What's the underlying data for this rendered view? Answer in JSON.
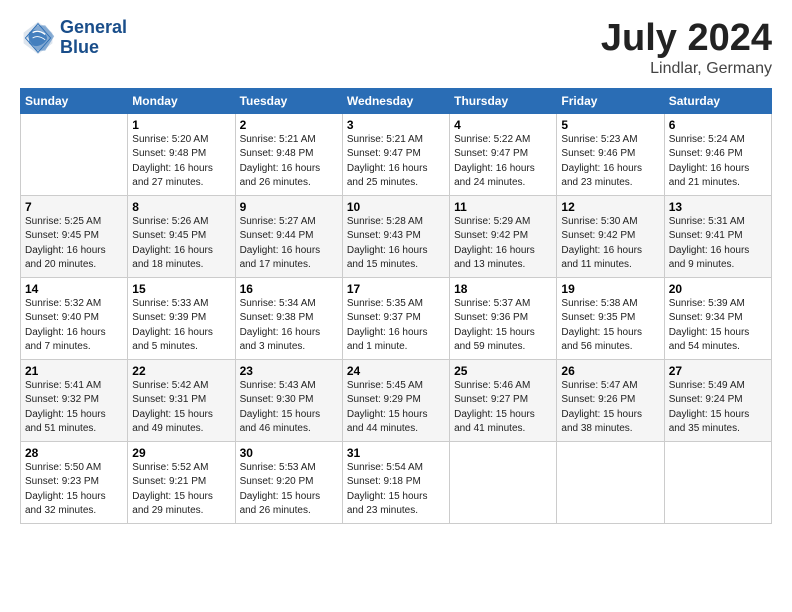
{
  "header": {
    "logo_line1": "General",
    "logo_line2": "Blue",
    "title": "July 2024",
    "location": "Lindlar, Germany"
  },
  "columns": [
    "Sunday",
    "Monday",
    "Tuesday",
    "Wednesday",
    "Thursday",
    "Friday",
    "Saturday"
  ],
  "weeks": [
    [
      {
        "day": "",
        "info": ""
      },
      {
        "day": "1",
        "info": "Sunrise: 5:20 AM\nSunset: 9:48 PM\nDaylight: 16 hours\nand 27 minutes."
      },
      {
        "day": "2",
        "info": "Sunrise: 5:21 AM\nSunset: 9:48 PM\nDaylight: 16 hours\nand 26 minutes."
      },
      {
        "day": "3",
        "info": "Sunrise: 5:21 AM\nSunset: 9:47 PM\nDaylight: 16 hours\nand 25 minutes."
      },
      {
        "day": "4",
        "info": "Sunrise: 5:22 AM\nSunset: 9:47 PM\nDaylight: 16 hours\nand 24 minutes."
      },
      {
        "day": "5",
        "info": "Sunrise: 5:23 AM\nSunset: 9:46 PM\nDaylight: 16 hours\nand 23 minutes."
      },
      {
        "day": "6",
        "info": "Sunrise: 5:24 AM\nSunset: 9:46 PM\nDaylight: 16 hours\nand 21 minutes."
      }
    ],
    [
      {
        "day": "7",
        "info": "Sunrise: 5:25 AM\nSunset: 9:45 PM\nDaylight: 16 hours\nand 20 minutes."
      },
      {
        "day": "8",
        "info": "Sunrise: 5:26 AM\nSunset: 9:45 PM\nDaylight: 16 hours\nand 18 minutes."
      },
      {
        "day": "9",
        "info": "Sunrise: 5:27 AM\nSunset: 9:44 PM\nDaylight: 16 hours\nand 17 minutes."
      },
      {
        "day": "10",
        "info": "Sunrise: 5:28 AM\nSunset: 9:43 PM\nDaylight: 16 hours\nand 15 minutes."
      },
      {
        "day": "11",
        "info": "Sunrise: 5:29 AM\nSunset: 9:42 PM\nDaylight: 16 hours\nand 13 minutes."
      },
      {
        "day": "12",
        "info": "Sunrise: 5:30 AM\nSunset: 9:42 PM\nDaylight: 16 hours\nand 11 minutes."
      },
      {
        "day": "13",
        "info": "Sunrise: 5:31 AM\nSunset: 9:41 PM\nDaylight: 16 hours\nand 9 minutes."
      }
    ],
    [
      {
        "day": "14",
        "info": "Sunrise: 5:32 AM\nSunset: 9:40 PM\nDaylight: 16 hours\nand 7 minutes."
      },
      {
        "day": "15",
        "info": "Sunrise: 5:33 AM\nSunset: 9:39 PM\nDaylight: 16 hours\nand 5 minutes."
      },
      {
        "day": "16",
        "info": "Sunrise: 5:34 AM\nSunset: 9:38 PM\nDaylight: 16 hours\nand 3 minutes."
      },
      {
        "day": "17",
        "info": "Sunrise: 5:35 AM\nSunset: 9:37 PM\nDaylight: 16 hours\nand 1 minute."
      },
      {
        "day": "18",
        "info": "Sunrise: 5:37 AM\nSunset: 9:36 PM\nDaylight: 15 hours\nand 59 minutes."
      },
      {
        "day": "19",
        "info": "Sunrise: 5:38 AM\nSunset: 9:35 PM\nDaylight: 15 hours\nand 56 minutes."
      },
      {
        "day": "20",
        "info": "Sunrise: 5:39 AM\nSunset: 9:34 PM\nDaylight: 15 hours\nand 54 minutes."
      }
    ],
    [
      {
        "day": "21",
        "info": "Sunrise: 5:41 AM\nSunset: 9:32 PM\nDaylight: 15 hours\nand 51 minutes."
      },
      {
        "day": "22",
        "info": "Sunrise: 5:42 AM\nSunset: 9:31 PM\nDaylight: 15 hours\nand 49 minutes."
      },
      {
        "day": "23",
        "info": "Sunrise: 5:43 AM\nSunset: 9:30 PM\nDaylight: 15 hours\nand 46 minutes."
      },
      {
        "day": "24",
        "info": "Sunrise: 5:45 AM\nSunset: 9:29 PM\nDaylight: 15 hours\nand 44 minutes."
      },
      {
        "day": "25",
        "info": "Sunrise: 5:46 AM\nSunset: 9:27 PM\nDaylight: 15 hours\nand 41 minutes."
      },
      {
        "day": "26",
        "info": "Sunrise: 5:47 AM\nSunset: 9:26 PM\nDaylight: 15 hours\nand 38 minutes."
      },
      {
        "day": "27",
        "info": "Sunrise: 5:49 AM\nSunset: 9:24 PM\nDaylight: 15 hours\nand 35 minutes."
      }
    ],
    [
      {
        "day": "28",
        "info": "Sunrise: 5:50 AM\nSunset: 9:23 PM\nDaylight: 15 hours\nand 32 minutes."
      },
      {
        "day": "29",
        "info": "Sunrise: 5:52 AM\nSunset: 9:21 PM\nDaylight: 15 hours\nand 29 minutes."
      },
      {
        "day": "30",
        "info": "Sunrise: 5:53 AM\nSunset: 9:20 PM\nDaylight: 15 hours\nand 26 minutes."
      },
      {
        "day": "31",
        "info": "Sunrise: 5:54 AM\nSunset: 9:18 PM\nDaylight: 15 hours\nand 23 minutes."
      },
      {
        "day": "",
        "info": ""
      },
      {
        "day": "",
        "info": ""
      },
      {
        "day": "",
        "info": ""
      }
    ]
  ]
}
